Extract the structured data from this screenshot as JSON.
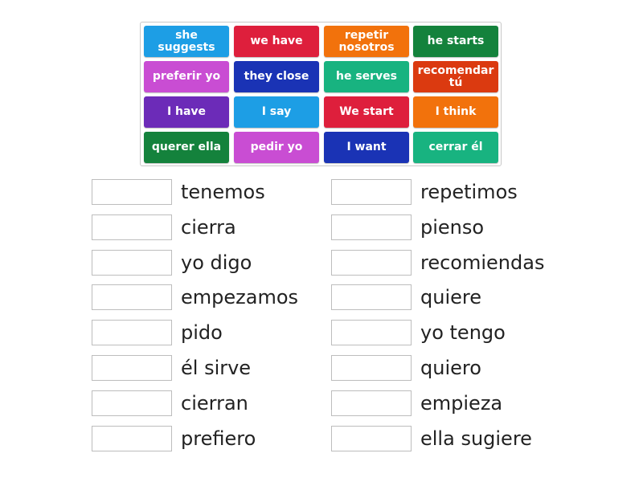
{
  "cards": [
    {
      "label": "she suggests",
      "color": "#1d9ee5"
    },
    {
      "label": "we have",
      "color": "#de1f3c"
    },
    {
      "label": "repetir nosotros",
      "color": "#f2720c"
    },
    {
      "label": "he starts",
      "color": "#14823c"
    },
    {
      "label": "preferir yo",
      "color": "#c94dd3"
    },
    {
      "label": "they close",
      "color": "#1a33b5"
    },
    {
      "label": "he serves",
      "color": "#18b380"
    },
    {
      "label": "recomendar tú",
      "color": "#db3a10"
    },
    {
      "label": "I have",
      "color": "#6c2bb8"
    },
    {
      "label": "I say",
      "color": "#1d9ee5"
    },
    {
      "label": "We start",
      "color": "#de1f3c"
    },
    {
      "label": "I think",
      "color": "#f2720c"
    },
    {
      "label": "querer ella",
      "color": "#14823c"
    },
    {
      "label": "pedir yo",
      "color": "#c94dd3"
    },
    {
      "label": "I want",
      "color": "#1a33b5"
    },
    {
      "label": "cerrar él",
      "color": "#18b380"
    }
  ],
  "targets_left": [
    {
      "word": "tenemos",
      "answer": ""
    },
    {
      "word": "cierra",
      "answer": ""
    },
    {
      "word": "yo digo",
      "answer": ""
    },
    {
      "word": "empezamos",
      "answer": ""
    },
    {
      "word": "pido",
      "answer": ""
    },
    {
      "word": "él sirve",
      "answer": ""
    },
    {
      "word": "cierran",
      "answer": ""
    },
    {
      "word": "prefiero",
      "answer": ""
    }
  ],
  "targets_right": [
    {
      "word": "repetimos",
      "answer": ""
    },
    {
      "word": "pienso",
      "answer": ""
    },
    {
      "word": "recomiendas",
      "answer": ""
    },
    {
      "word": "quiere",
      "answer": ""
    },
    {
      "word": "yo tengo",
      "answer": ""
    },
    {
      "word": "quiero",
      "answer": ""
    },
    {
      "word": "empieza",
      "answer": ""
    },
    {
      "word": "ella sugiere",
      "answer": ""
    }
  ]
}
